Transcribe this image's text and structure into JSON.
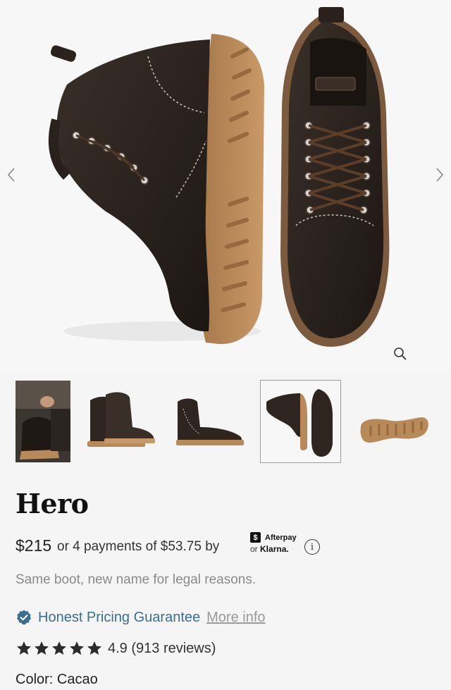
{
  "gallery": {
    "prev_icon": "chevron-left-icon",
    "next_icon": "chevron-right-icon",
    "zoom_icon": "magnifier-icon",
    "active_thumbnail_index": 3
  },
  "product": {
    "title": "Hero",
    "price": "$215",
    "installments": "or 4 payments of $53.75 by",
    "afterpay_label": "Afterpay",
    "afterpay_glyph": "$",
    "klarna_prefix": "or",
    "klarna_label": "Klarna.",
    "info_glyph": "i",
    "tagline": "Same boot, new name for legal reasons.",
    "guarantee": "Honest Pricing Guarantee",
    "more_info": "More info",
    "rating_value": 4.9,
    "rating_text": "4.9 (913 reviews)",
    "color_label": "Color: Cacao"
  },
  "colors": {
    "guarantee_blue": "#3a6f8f",
    "leather": "#2e2520",
    "sole": "#b88a5a"
  }
}
